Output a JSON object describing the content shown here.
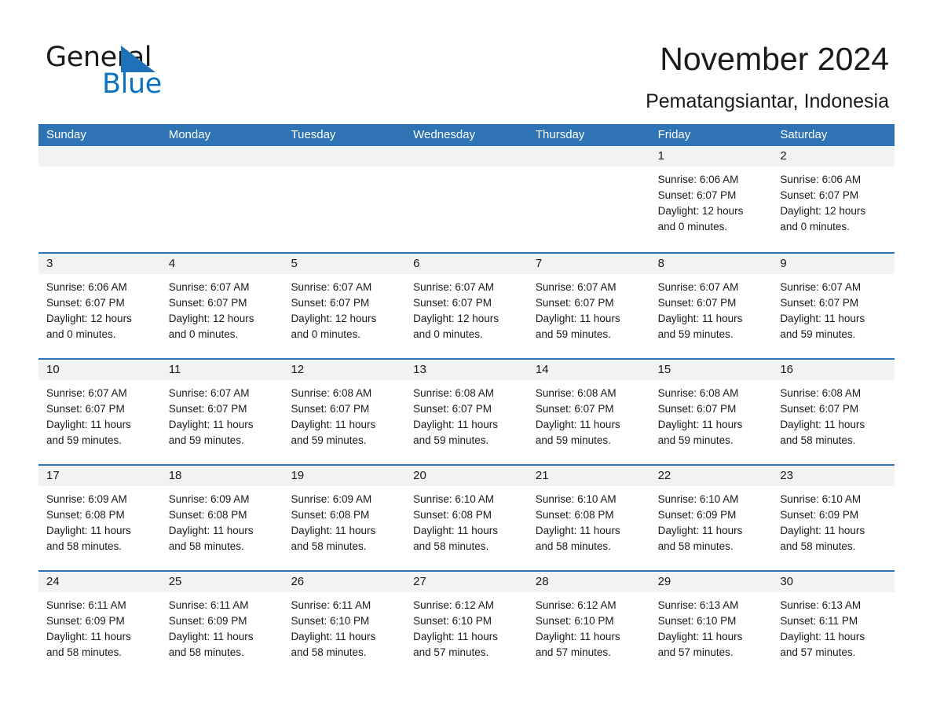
{
  "brand": {
    "name_part1": "General",
    "name_part2": "Blue",
    "logo_icon": "triangle-icon",
    "accent_color": "#1f72b8"
  },
  "header": {
    "title": "November 2024",
    "subtitle": "Pematangsiantar, Indonesia"
  },
  "theme": {
    "header_bg": "#2e74b5",
    "header_text": "#ffffff",
    "daynum_bg": "#f2f2f2",
    "divider": "#2e74b5",
    "body_text": "#1a1a1a"
  },
  "weekday_headers": [
    "Sunday",
    "Monday",
    "Tuesday",
    "Wednesday",
    "Thursday",
    "Friday",
    "Saturday"
  ],
  "weeks": [
    [
      {
        "day": "",
        "empty": true,
        "sunrise": "",
        "sunset": "",
        "daylight1": "",
        "daylight2": ""
      },
      {
        "day": "",
        "empty": true,
        "sunrise": "",
        "sunset": "",
        "daylight1": "",
        "daylight2": ""
      },
      {
        "day": "",
        "empty": true,
        "sunrise": "",
        "sunset": "",
        "daylight1": "",
        "daylight2": ""
      },
      {
        "day": "",
        "empty": true,
        "sunrise": "",
        "sunset": "",
        "daylight1": "",
        "daylight2": ""
      },
      {
        "day": "",
        "empty": true,
        "sunrise": "",
        "sunset": "",
        "daylight1": "",
        "daylight2": ""
      },
      {
        "day": "1",
        "empty": false,
        "sunrise": "Sunrise: 6:06 AM",
        "sunset": "Sunset: 6:07 PM",
        "daylight1": "Daylight: 12 hours",
        "daylight2": "and 0 minutes."
      },
      {
        "day": "2",
        "empty": false,
        "sunrise": "Sunrise: 6:06 AM",
        "sunset": "Sunset: 6:07 PM",
        "daylight1": "Daylight: 12 hours",
        "daylight2": "and 0 minutes."
      }
    ],
    [
      {
        "day": "3",
        "empty": false,
        "sunrise": "Sunrise: 6:06 AM",
        "sunset": "Sunset: 6:07 PM",
        "daylight1": "Daylight: 12 hours",
        "daylight2": "and 0 minutes."
      },
      {
        "day": "4",
        "empty": false,
        "sunrise": "Sunrise: 6:07 AM",
        "sunset": "Sunset: 6:07 PM",
        "daylight1": "Daylight: 12 hours",
        "daylight2": "and 0 minutes."
      },
      {
        "day": "5",
        "empty": false,
        "sunrise": "Sunrise: 6:07 AM",
        "sunset": "Sunset: 6:07 PM",
        "daylight1": "Daylight: 12 hours",
        "daylight2": "and 0 minutes."
      },
      {
        "day": "6",
        "empty": false,
        "sunrise": "Sunrise: 6:07 AM",
        "sunset": "Sunset: 6:07 PM",
        "daylight1": "Daylight: 12 hours",
        "daylight2": "and 0 minutes."
      },
      {
        "day": "7",
        "empty": false,
        "sunrise": "Sunrise: 6:07 AM",
        "sunset": "Sunset: 6:07 PM",
        "daylight1": "Daylight: 11 hours",
        "daylight2": "and 59 minutes."
      },
      {
        "day": "8",
        "empty": false,
        "sunrise": "Sunrise: 6:07 AM",
        "sunset": "Sunset: 6:07 PM",
        "daylight1": "Daylight: 11 hours",
        "daylight2": "and 59 minutes."
      },
      {
        "day": "9",
        "empty": false,
        "sunrise": "Sunrise: 6:07 AM",
        "sunset": "Sunset: 6:07 PM",
        "daylight1": "Daylight: 11 hours",
        "daylight2": "and 59 minutes."
      }
    ],
    [
      {
        "day": "10",
        "empty": false,
        "sunrise": "Sunrise: 6:07 AM",
        "sunset": "Sunset: 6:07 PM",
        "daylight1": "Daylight: 11 hours",
        "daylight2": "and 59 minutes."
      },
      {
        "day": "11",
        "empty": false,
        "sunrise": "Sunrise: 6:07 AM",
        "sunset": "Sunset: 6:07 PM",
        "daylight1": "Daylight: 11 hours",
        "daylight2": "and 59 minutes."
      },
      {
        "day": "12",
        "empty": false,
        "sunrise": "Sunrise: 6:08 AM",
        "sunset": "Sunset: 6:07 PM",
        "daylight1": "Daylight: 11 hours",
        "daylight2": "and 59 minutes."
      },
      {
        "day": "13",
        "empty": false,
        "sunrise": "Sunrise: 6:08 AM",
        "sunset": "Sunset: 6:07 PM",
        "daylight1": "Daylight: 11 hours",
        "daylight2": "and 59 minutes."
      },
      {
        "day": "14",
        "empty": false,
        "sunrise": "Sunrise: 6:08 AM",
        "sunset": "Sunset: 6:07 PM",
        "daylight1": "Daylight: 11 hours",
        "daylight2": "and 59 minutes."
      },
      {
        "day": "15",
        "empty": false,
        "sunrise": "Sunrise: 6:08 AM",
        "sunset": "Sunset: 6:07 PM",
        "daylight1": "Daylight: 11 hours",
        "daylight2": "and 59 minutes."
      },
      {
        "day": "16",
        "empty": false,
        "sunrise": "Sunrise: 6:08 AM",
        "sunset": "Sunset: 6:07 PM",
        "daylight1": "Daylight: 11 hours",
        "daylight2": "and 58 minutes."
      }
    ],
    [
      {
        "day": "17",
        "empty": false,
        "sunrise": "Sunrise: 6:09 AM",
        "sunset": "Sunset: 6:08 PM",
        "daylight1": "Daylight: 11 hours",
        "daylight2": "and 58 minutes."
      },
      {
        "day": "18",
        "empty": false,
        "sunrise": "Sunrise: 6:09 AM",
        "sunset": "Sunset: 6:08 PM",
        "daylight1": "Daylight: 11 hours",
        "daylight2": "and 58 minutes."
      },
      {
        "day": "19",
        "empty": false,
        "sunrise": "Sunrise: 6:09 AM",
        "sunset": "Sunset: 6:08 PM",
        "daylight1": "Daylight: 11 hours",
        "daylight2": "and 58 minutes."
      },
      {
        "day": "20",
        "empty": false,
        "sunrise": "Sunrise: 6:10 AM",
        "sunset": "Sunset: 6:08 PM",
        "daylight1": "Daylight: 11 hours",
        "daylight2": "and 58 minutes."
      },
      {
        "day": "21",
        "empty": false,
        "sunrise": "Sunrise: 6:10 AM",
        "sunset": "Sunset: 6:08 PM",
        "daylight1": "Daylight: 11 hours",
        "daylight2": "and 58 minutes."
      },
      {
        "day": "22",
        "empty": false,
        "sunrise": "Sunrise: 6:10 AM",
        "sunset": "Sunset: 6:09 PM",
        "daylight1": "Daylight: 11 hours",
        "daylight2": "and 58 minutes."
      },
      {
        "day": "23",
        "empty": false,
        "sunrise": "Sunrise: 6:10 AM",
        "sunset": "Sunset: 6:09 PM",
        "daylight1": "Daylight: 11 hours",
        "daylight2": "and 58 minutes."
      }
    ],
    [
      {
        "day": "24",
        "empty": false,
        "sunrise": "Sunrise: 6:11 AM",
        "sunset": "Sunset: 6:09 PM",
        "daylight1": "Daylight: 11 hours",
        "daylight2": "and 58 minutes."
      },
      {
        "day": "25",
        "empty": false,
        "sunrise": "Sunrise: 6:11 AM",
        "sunset": "Sunset: 6:09 PM",
        "daylight1": "Daylight: 11 hours",
        "daylight2": "and 58 minutes."
      },
      {
        "day": "26",
        "empty": false,
        "sunrise": "Sunrise: 6:11 AM",
        "sunset": "Sunset: 6:10 PM",
        "daylight1": "Daylight: 11 hours",
        "daylight2": "and 58 minutes."
      },
      {
        "day": "27",
        "empty": false,
        "sunrise": "Sunrise: 6:12 AM",
        "sunset": "Sunset: 6:10 PM",
        "daylight1": "Daylight: 11 hours",
        "daylight2": "and 57 minutes."
      },
      {
        "day": "28",
        "empty": false,
        "sunrise": "Sunrise: 6:12 AM",
        "sunset": "Sunset: 6:10 PM",
        "daylight1": "Daylight: 11 hours",
        "daylight2": "and 57 minutes."
      },
      {
        "day": "29",
        "empty": false,
        "sunrise": "Sunrise: 6:13 AM",
        "sunset": "Sunset: 6:10 PM",
        "daylight1": "Daylight: 11 hours",
        "daylight2": "and 57 minutes."
      },
      {
        "day": "30",
        "empty": false,
        "sunrise": "Sunrise: 6:13 AM",
        "sunset": "Sunset: 6:11 PM",
        "daylight1": "Daylight: 11 hours",
        "daylight2": "and 57 minutes."
      }
    ]
  ]
}
